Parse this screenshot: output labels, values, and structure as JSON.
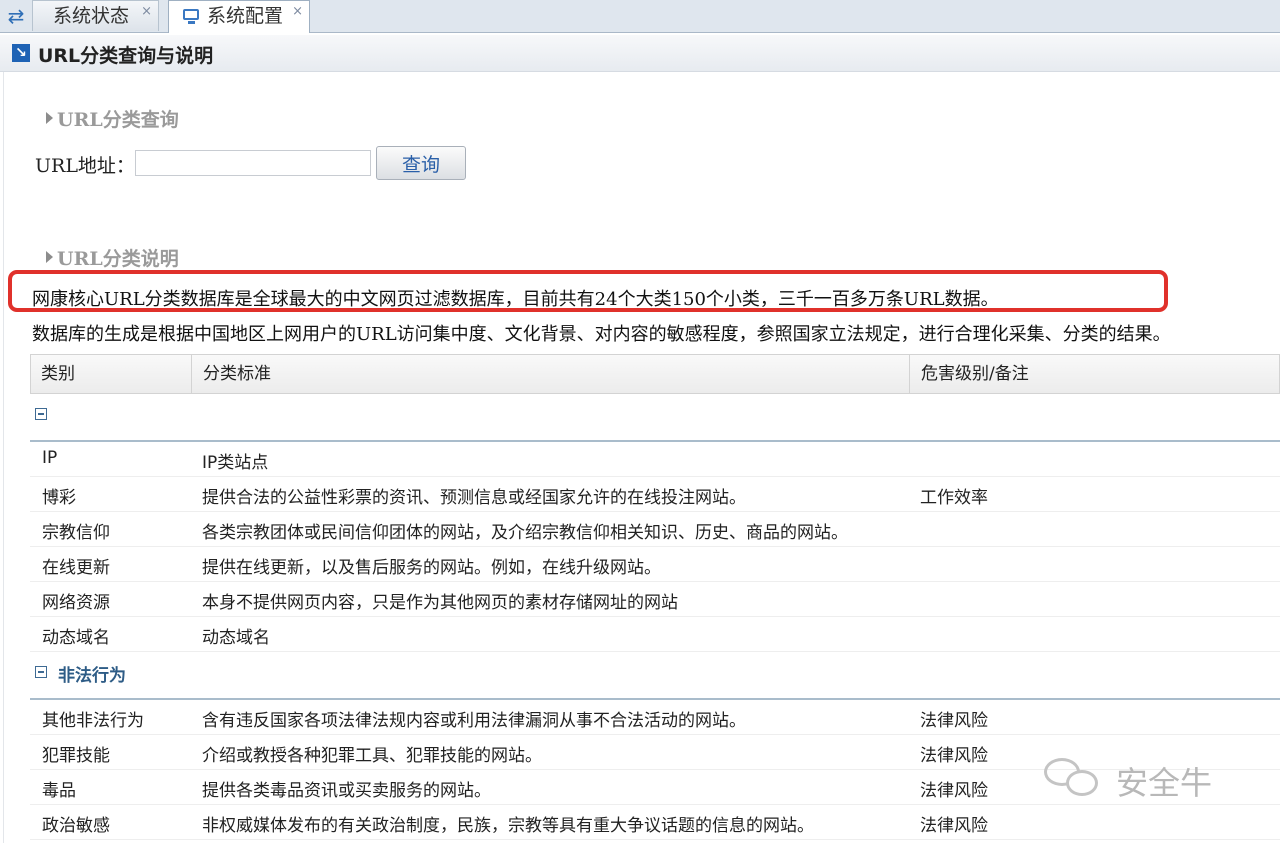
{
  "tabs": [
    {
      "label": "系统状态",
      "close": "×"
    },
    {
      "label": "系统配置",
      "close": "×"
    }
  ],
  "header": {
    "title": "URL分类查询与说明"
  },
  "query_section": {
    "title": "URL分类查询",
    "url_label": "URL地址：",
    "url_value": "",
    "button": "查询"
  },
  "desc_section": {
    "title": "URL分类说明",
    "line1": "网康核心URL分类数据库是全球最大的中文网页过滤数据库，目前共有24个大类150个小类，三千一百多万条URL数据。",
    "line2": "数据库的生成是根据中国地区上网用户的URL访问集中度、文化背景、对内容的敏感程度，参照国家立法规定，进行合理化采集、分类的结果。"
  },
  "table": {
    "headers": [
      "类别",
      "分类标准",
      "危害级别/备注"
    ],
    "groups": [
      {
        "name": "",
        "rows": [
          [
            "IP",
            "IP类站点",
            ""
          ],
          [
            "博彩",
            "提供合法的公益性彩票的资讯、预测信息或经国家允许的在线投注网站。",
            "工作效率"
          ],
          [
            "宗教信仰",
            "各类宗教团体或民间信仰团体的网站，及介绍宗教信仰相关知识、历史、商品的网站。",
            ""
          ],
          [
            "在线更新",
            "提供在线更新，以及售后服务的网站。例如，在线升级网站。",
            ""
          ],
          [
            "网络资源",
            "本身不提供网页内容，只是作为其他网页的素材存储网址的网站",
            ""
          ],
          [
            "动态域名",
            "动态域名",
            ""
          ]
        ]
      },
      {
        "name": "非法行为",
        "rows": [
          [
            "其他非法行为",
            "含有违反国家各项法律法规内容或利用法律漏洞从事不合法活动的网站。",
            "法律风险"
          ],
          [
            "犯罪技能",
            "介绍或教授各种犯罪工具、犯罪技能的网站。",
            "法律风险"
          ],
          [
            "毒品",
            "提供各类毒品资讯或买卖服务的网站。",
            "法律风险"
          ],
          [
            "政治敏感",
            "非权威媒体发布的有关政治制度，民族，宗教等具有重大争议话题的信息的网站。",
            "法律风险"
          ]
        ]
      }
    ]
  },
  "watermark": {
    "text": "安全牛"
  },
  "colors": {
    "highlight_box": "#e0312b",
    "accent": "#2e5c86"
  }
}
